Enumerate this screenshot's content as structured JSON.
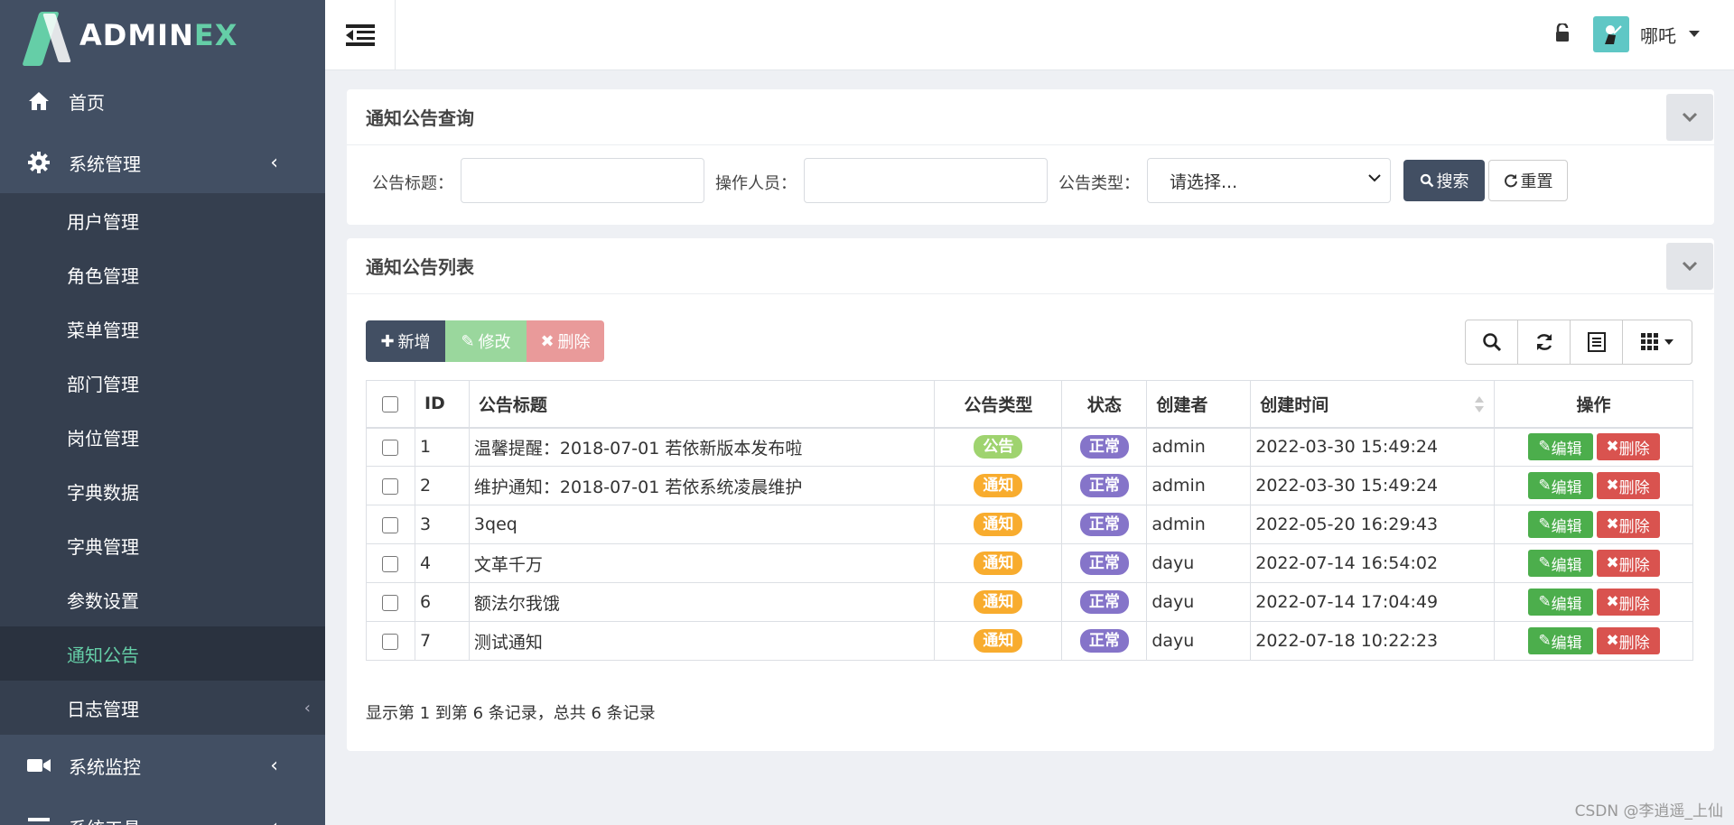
{
  "app": {
    "logo_text_main": "ADMIN",
    "logo_text_accent": "EX"
  },
  "sidebar": {
    "items": [
      {
        "label": "首页",
        "icon": "home-icon"
      },
      {
        "label": "系统管理",
        "icon": "gear-icon"
      }
    ],
    "sub_items": [
      {
        "label": "用户管理"
      },
      {
        "label": "角色管理"
      },
      {
        "label": "菜单管理"
      },
      {
        "label": "部门管理"
      },
      {
        "label": "岗位管理"
      },
      {
        "label": "字典数据"
      },
      {
        "label": "字典管理"
      },
      {
        "label": "参数设置"
      },
      {
        "label": "通知公告",
        "active": true
      },
      {
        "label": "日志管理"
      }
    ],
    "bottom_items": [
      {
        "label": "系统监控",
        "icon": "video-camera-icon"
      },
      {
        "label": "系统工具",
        "icon": "bars-icon"
      }
    ]
  },
  "header": {
    "user_name": "哪吒"
  },
  "query_panel": {
    "title": "通知公告查询",
    "fields": {
      "title_label": "公告标题：",
      "operator_label": "操作人员：",
      "type_label": "公告类型：",
      "type_selected": "请选择..."
    },
    "search_label": "搜索",
    "reset_label": "重置"
  },
  "list_panel": {
    "title": "通知公告列表",
    "toolbar": {
      "add": "新增",
      "edit": "修改",
      "delete": "删除"
    },
    "columns": [
      "ID",
      "公告标题",
      "公告类型",
      "状态",
      "创建者",
      "创建时间",
      "操作"
    ],
    "rows": [
      {
        "id": "1",
        "title": "温馨提醒：2018-07-01 若依新版本发布啦",
        "type": "公告",
        "type_color": "#9fd36f",
        "status": "正常",
        "creator": "admin",
        "created": "2022-03-30 15:49:24"
      },
      {
        "id": "2",
        "title": "维护通知：2018-07-01 若依系统凌晨维护",
        "type": "通知",
        "type_color": "#f8ac2e",
        "status": "正常",
        "creator": "admin",
        "created": "2022-03-30 15:49:24"
      },
      {
        "id": "3",
        "title": "3qeq",
        "type": "通知",
        "type_color": "#f8ac2e",
        "status": "正常",
        "creator": "admin",
        "created": "2022-05-20 16:29:43"
      },
      {
        "id": "4",
        "title": "文革千万",
        "type": "通知",
        "type_color": "#f8ac2e",
        "status": "正常",
        "creator": "dayu",
        "created": "2022-07-14 16:54:02"
      },
      {
        "id": "6",
        "title": "额法尔我饿",
        "type": "通知",
        "type_color": "#f8ac2e",
        "status": "正常",
        "creator": "dayu",
        "created": "2022-07-14 17:04:49"
      },
      {
        "id": "7",
        "title": "测试通知",
        "type": "通知",
        "type_color": "#f8ac2e",
        "status": "正常",
        "creator": "dayu",
        "created": "2022-07-18 10:22:23"
      }
    ],
    "row_actions": {
      "edit": "编辑",
      "delete": "删除"
    },
    "pagination_text": "显示第 1 到第 6 条记录，总共 6 条记录"
  },
  "watermark": "CSDN @李逍遥_上仙",
  "colors": {
    "sidebar": "#424f63",
    "accent": "#65cea7",
    "edit_green": "#4cae4c",
    "delete_red": "#d9534f"
  }
}
